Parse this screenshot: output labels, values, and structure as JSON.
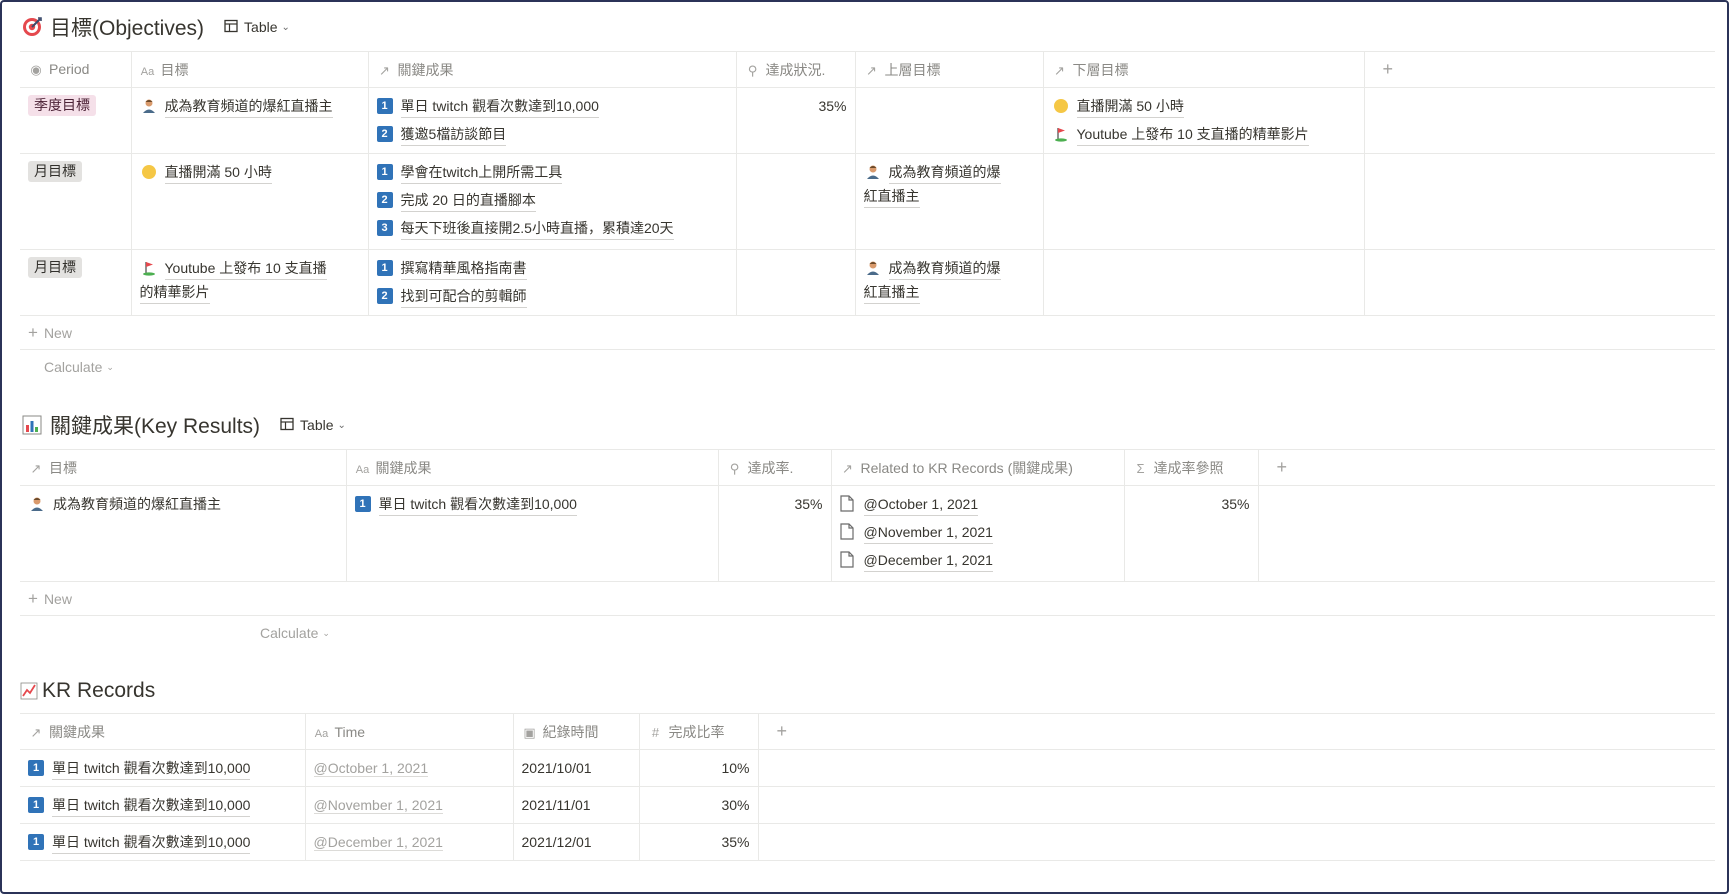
{
  "objectives": {
    "title": "目標(Objectives)",
    "view_label": "Table",
    "columns": [
      "Period",
      "目標",
      "關鍵成果",
      "達成狀況.",
      "上層目標",
      "下層目標"
    ],
    "rows": [
      {
        "period": "季度目標",
        "goal": "成為教育頻道的爆紅直播主",
        "key_results": [
          {
            "n": "1",
            "text": "單日 twitch 觀看次數達到10,000"
          },
          {
            "n": "2",
            "text": "獲邀5檔訪談節目"
          }
        ],
        "status": "35%",
        "parent_line1": "",
        "parent_line2": "",
        "children": [
          "直播開滿 50 小時",
          "Youtube 上發布 10 支直播的精華影片"
        ]
      },
      {
        "period": "月目標",
        "goal": "直播開滿 50 小時",
        "key_results": [
          {
            "n": "1",
            "text": "學會在twitch上開所需工具"
          },
          {
            "n": "2",
            "text": "完成 20 日的直播腳本"
          },
          {
            "n": "3",
            "text": "每天下班後直接開2.5小時直播，累積達20天"
          }
        ],
        "status": "",
        "parent_line1": "成為教育頻道的爆",
        "parent_line2": "紅直播主",
        "children": []
      },
      {
        "period": "月目標",
        "goal_line1": "Youtube 上發布 10 支直播",
        "goal_line2": "的精華影片",
        "key_results": [
          {
            "n": "1",
            "text": "撰寫精華風格指南書"
          },
          {
            "n": "2",
            "text": "找到可配合的剪輯師"
          }
        ],
        "status": "",
        "parent_line1": "成為教育頻道的爆",
        "parent_line2": "紅直播主",
        "children": []
      }
    ],
    "new_label": "New",
    "calculate_label": "Calculate"
  },
  "key_results": {
    "title": "關鍵成果(Key Results)",
    "view_label": "Table",
    "columns": [
      "目標",
      "關鍵成果",
      "達成率.",
      "Related to KR Records (關鍵成果)",
      "達成率參照"
    ],
    "rows": [
      {
        "goal": "成為教育頻道的爆紅直播主",
        "kr_n": "1",
        "kr": "單日 twitch 觀看次數達到10,000",
        "rate": "35%",
        "records": [
          "@October 1, 2021",
          "@November 1, 2021",
          "@December 1, 2021"
        ],
        "rate_ref": "35%"
      }
    ],
    "new_label": "New",
    "calculate_label": "Calculate"
  },
  "kr_records": {
    "title": "KR Records",
    "columns": [
      "關鍵成果",
      "Time",
      "紀錄時間",
      "完成比率"
    ],
    "rows": [
      {
        "kr_n": "1",
        "kr": "單日 twitch 觀看次數達到10,000",
        "time": "@October 1, 2021",
        "date": "2021/10/01",
        "pct": "10%"
      },
      {
        "kr_n": "1",
        "kr": "單日 twitch 觀看次數達到10,000",
        "time": "@November 1, 2021",
        "date": "2021/11/01",
        "pct": "30%"
      },
      {
        "kr_n": "1",
        "kr": "單日 twitch 觀看次數達到10,000",
        "time": "@December 1, 2021",
        "date": "2021/12/01",
        "pct": "35%"
      }
    ]
  },
  "colors": {
    "number_badge": "#3073b8",
    "tag_pink": "#f5e0e9",
    "tag_gray": "#e3e2e0",
    "border": "#e9e9e7",
    "muted_text": "#a3a29f"
  },
  "icons": {
    "objectives": "target-icon",
    "key_results": "bar-chart-icon",
    "kr_records": "line-chart-icon"
  }
}
